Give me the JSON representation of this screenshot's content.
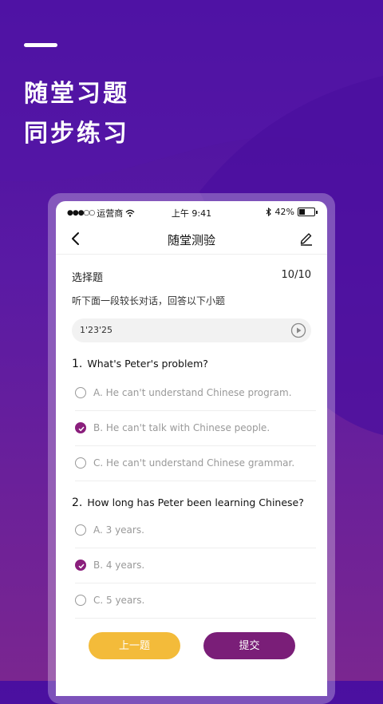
{
  "hero": {
    "line1": "随堂习题",
    "line2": "同步练习"
  },
  "colors": {
    "accent_purple": "#7a1e78",
    "check_purple": "#8a1f7c",
    "prev_yellow": "#f3bb3a"
  },
  "status_bar": {
    "signal": "●●●○○",
    "carrier": "运营商",
    "time": "上午 9:41",
    "battery": "42%",
    "battery_level": 0.42
  },
  "nav": {
    "title": "随堂测验",
    "back_icon": "chevron-left-icon",
    "edit_icon": "pencil-icon"
  },
  "section": {
    "title": "选择题",
    "count": "10/10"
  },
  "instruction": "听下面一段较长对话，回答以下小题",
  "audio": {
    "time": "1'23'25",
    "icon": "play-icon"
  },
  "questions": [
    {
      "number": "1.",
      "text": "What's Peter's problem?",
      "options": [
        {
          "label": "A. He can't understand Chinese program.",
          "checked": false
        },
        {
          "label": "B. He can't talk with Chinese people.",
          "checked": true
        },
        {
          "label": "C. He can't understand Chinese grammar.",
          "checked": false
        }
      ]
    },
    {
      "number": "2.",
      "text": "How long has Peter been learning Chinese?",
      "options": [
        {
          "label": "A. 3 years.",
          "checked": false
        },
        {
          "label": "B. 4  years.",
          "checked": true
        },
        {
          "label": "C. 5 years.",
          "checked": false
        }
      ]
    }
  ],
  "buttons": {
    "prev": "上一题",
    "submit": "提交"
  }
}
